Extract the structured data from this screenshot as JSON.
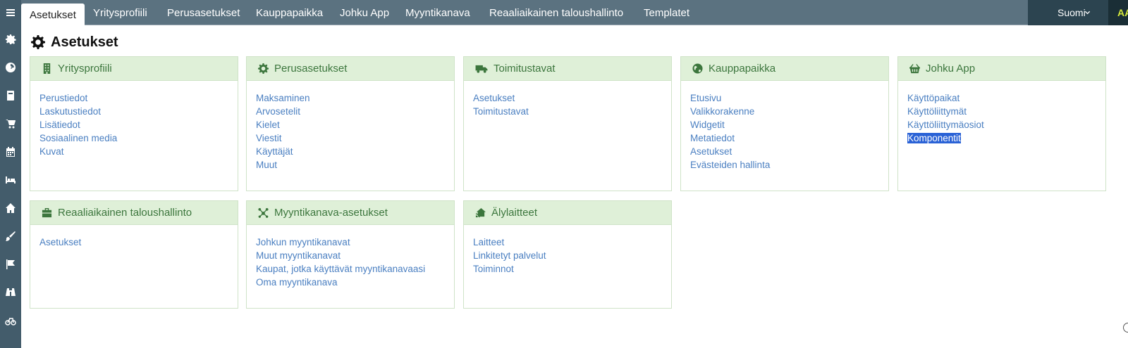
{
  "sidebar": {
    "icons": [
      "menu-icon",
      "settings-icon",
      "dashboard-icon",
      "book-icon",
      "cart-icon",
      "calendar-icon",
      "bed-icon",
      "home-icon",
      "paintbrush-icon",
      "flag-icon",
      "binoculars-icon",
      "bicycle-icon"
    ]
  },
  "topnav": {
    "tabs": [
      {
        "label": "Asetukset"
      },
      {
        "label": "Yritysprofiili"
      },
      {
        "label": "Perusasetukset"
      },
      {
        "label": "Kauppapaikka"
      },
      {
        "label": "Johku App"
      },
      {
        "label": "Myyntikanava"
      },
      {
        "label": "Reaaliaikainen taloushallinto"
      },
      {
        "label": "Templatet"
      }
    ],
    "language": "Suomi",
    "account": "AA"
  },
  "page": {
    "title": "Asetukset"
  },
  "cards": [
    {
      "title": "Yritysprofiili",
      "icon": "building-icon",
      "links": [
        "Perustiedot",
        "Laskutustiedot",
        "Lisätiedot",
        "Sosiaalinen media",
        "Kuvat"
      ]
    },
    {
      "title": "Perusasetukset",
      "icon": "gear-icon",
      "links": [
        "Maksaminen",
        "Arvosetelit",
        "Kielet",
        "Viestit",
        "Käyttäjät",
        "Muut"
      ]
    },
    {
      "title": "Toimitustavat",
      "icon": "truck-icon",
      "links": [
        "Asetukset",
        "Toimitustavat"
      ]
    },
    {
      "title": "Kauppapaikka",
      "icon": "globe-icon",
      "links": [
        "Etusivu",
        "Valikkorakenne",
        "Widgetit",
        "Metatiedot",
        "Asetukset",
        "Evästeiden hallinta"
      ]
    },
    {
      "title": "Johku App",
      "icon": "basket-icon",
      "links": [
        "Käyttöpaikat",
        "Käyttöliittymät",
        "Käyttöliittymäosiot",
        "Komponentit"
      ],
      "selected_link": "Komponentit"
    },
    {
      "title": "Reaaliaikainen taloushallinto",
      "icon": "briefcase-icon",
      "links": [
        "Asetukset"
      ]
    },
    {
      "title": "Myyntikanava-asetukset",
      "icon": "network-icon",
      "links": [
        "Johkun myyntikanavat",
        "Muut myyntikanavat",
        "Kaupat, jotka käyttävät myyntikanavaasi",
        "Oma myyntikanava"
      ]
    },
    {
      "title": "Älylaitteet",
      "icon": "smart-home-icon",
      "links": [
        "Laitteet",
        "Linkitetyt palvelut",
        "Toiminnot"
      ]
    }
  ],
  "colors": {
    "topbar": "#5b7280",
    "sidebar": "#435c6b",
    "card_header": "#dff0d8",
    "card_title": "#3c763d",
    "link": "#4a7fc1",
    "selection": "#2a62d6"
  }
}
